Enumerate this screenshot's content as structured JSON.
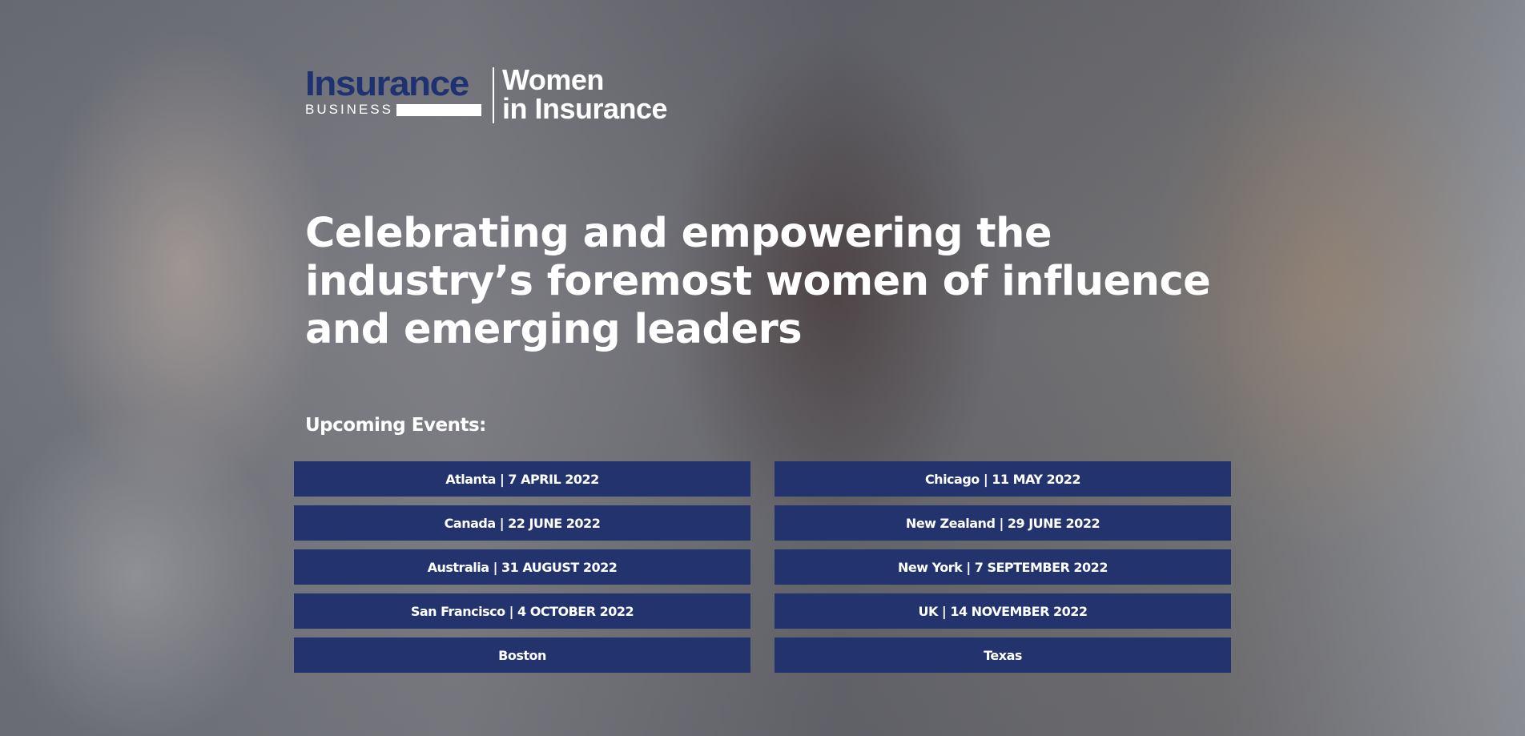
{
  "brand": {
    "ib_word": "Insurance",
    "ib_sub": "BUSINESS",
    "wii_line1": "Women",
    "wii_line2": "in Insurance",
    "colors": {
      "navy": "#1e3170",
      "button": "#22336d",
      "text": "#ffffff"
    }
  },
  "hero": {
    "headline": "Celebrating and empowering the industry’s foremost women of influence and emerging leaders",
    "events_label": "Upcoming Events:"
  },
  "events": [
    {
      "label": "Atlanta | 7 APRIL 2022"
    },
    {
      "label": "Chicago | 11 MAY 2022"
    },
    {
      "label": "Canada | 22 JUNE 2022"
    },
    {
      "label": "New Zealand | 29 JUNE 2022"
    },
    {
      "label": "Australia | 31 AUGUST 2022"
    },
    {
      "label": "New York | 7 SEPTEMBER 2022"
    },
    {
      "label": "San Francisco | 4 OCTOBER 2022"
    },
    {
      "label": "UK | 14 NOVEMBER 2022"
    },
    {
      "label": "Boston"
    },
    {
      "label": "Texas"
    }
  ]
}
